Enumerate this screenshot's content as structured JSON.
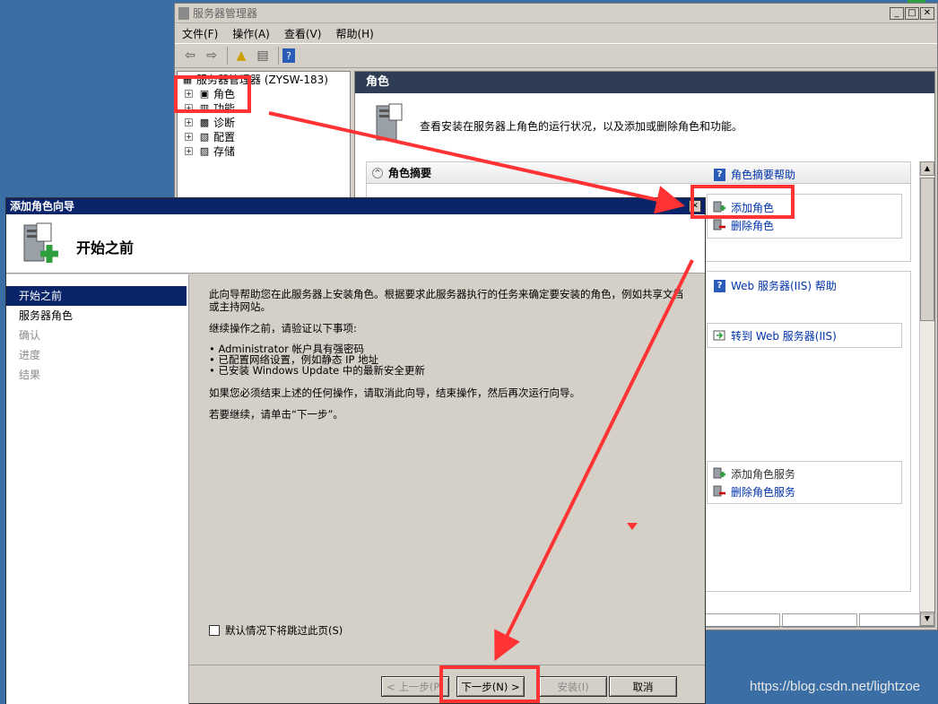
{
  "server_manager": {
    "title": "服务器管理器",
    "menu": [
      "文件(F)",
      "操作(A)",
      "查看(V)",
      "帮助(H)"
    ],
    "tree": {
      "root": "服务器管理器 (ZYSW-183)",
      "items": [
        "角色",
        "功能",
        "诊断",
        "配置",
        "存储"
      ]
    },
    "pane_title": "角色",
    "pane_description": "查看安装在服务器上角色的运行状况，以及添加或删除角色和功能。",
    "section_summary": "角色摘要",
    "summary_help": "角色摘要帮助",
    "add_role": "添加角色",
    "remove_role": "删除角色",
    "web_help": "Web 服务器(IIS) 帮助",
    "goto_web": "转到 Web 服务器(IIS)",
    "add_role_service": "添加角色服务",
    "remove_role_service": "删除角色服务"
  },
  "wizard": {
    "title": "添加角色向导",
    "header": "开始之前",
    "nav": [
      {
        "label": "开始之前",
        "state": "active"
      },
      {
        "label": "服务器角色",
        "state": "normal"
      },
      {
        "label": "确认",
        "state": "dim"
      },
      {
        "label": "进度",
        "state": "dim"
      },
      {
        "label": "结果",
        "state": "dim"
      }
    ],
    "intro": "此向导帮助您在此服务器上安装角色。根据要求此服务器执行的任务来确定要安装的角色，例如共享文档或主持网站。",
    "verify_heading": "继续操作之前，请验证以下事项:",
    "checklist": [
      "Administrator 帐户具有强密码",
      "已配置网络设置，例如静态 IP 地址",
      "已安装 Windows Update 中的最新安全更新"
    ],
    "cancel_note": "如果您必须结束上述的任何操作，请取消此向导，结束操作，然后再次运行向导。",
    "continue_note": "若要继续，请单击“下一步”。",
    "skip_checkbox": "默认情况下将跳过此页(S)",
    "buttons": {
      "prev": "< 上一步(P)",
      "next": "下一步(N) >",
      "install": "安装(I)",
      "cancel": "取消"
    }
  },
  "watermark": "https://blog.csdn.net/lightzoe",
  "colors": {
    "annotation_red": "#ff3333",
    "wizard_titlebar": "#0a246a",
    "pane_header": "#2e3d54",
    "link_blue": "#0033aa"
  }
}
